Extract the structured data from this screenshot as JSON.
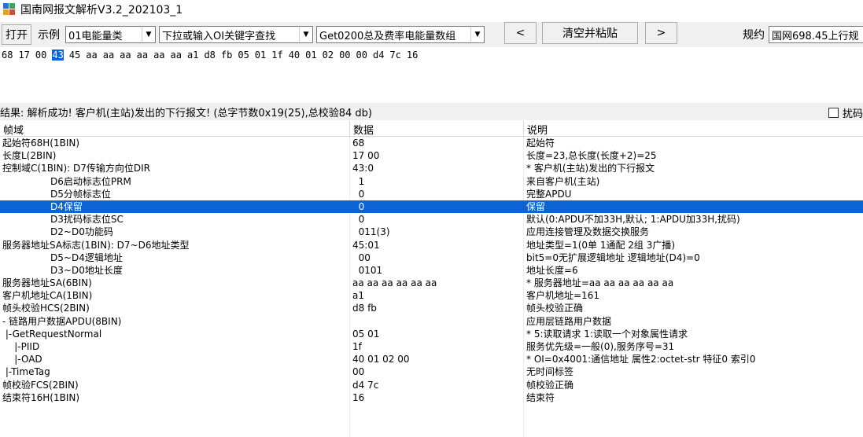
{
  "window": {
    "title": "国南网报文解析V3.2_202103_1"
  },
  "toolbar": {
    "open_label": "打开",
    "example_label": "示例",
    "example_combo": "01电能量类",
    "keyword_combo": "下拉或输入OI关键字查找",
    "frame_combo": "Get0200总及费率电能量数组",
    "prev_label": "<",
    "clear_paste_label": "清空并粘贴",
    "next_label": ">",
    "protocol_label": "规约",
    "protocol_value": "国网698.45上行规"
  },
  "hex": {
    "bytes": [
      "68",
      "17",
      "00",
      "43",
      "45",
      "aa",
      "aa",
      "aa",
      "aa",
      "aa",
      "aa",
      "a1",
      "d8",
      "fb",
      "05",
      "01",
      "1f",
      "40",
      "01",
      "02",
      "00",
      "00",
      "d4",
      "7c",
      "16"
    ],
    "selected_index": 3
  },
  "result": {
    "text": "结果: 解析成功! 客户机(主站)发出的下行报文! (总字节数0x19(25),总校验84 db)",
    "checkbox_label": "扰码"
  },
  "grid": {
    "headers": [
      "帧域",
      "数据",
      "说明"
    ],
    "selected_row": 5,
    "rows": [
      [
        "起始符68H(1BIN)",
        "68",
        "起始符"
      ],
      [
        "长度L(2BIN)",
        "17 00",
        "长度=23,总长度(长度+2)=25"
      ],
      [
        "控制域C(1BIN): D7传输方向位DIR",
        "43:0",
        "* 客户机(主站)发出的下行报文"
      ],
      [
        "                D6启动标志位PRM",
        "  1",
        "来自客户机(主站)"
      ],
      [
        "                D5分帧标志位",
        "  0",
        "完整APDU"
      ],
      [
        "                D4保留",
        "  0",
        "保留"
      ],
      [
        "                D3扰码标志位SC",
        "  0",
        "默认(0:APDU不加33H,默认; 1:APDU加33H,扰码)"
      ],
      [
        "                D2~D0功能码",
        "  011(3)",
        "应用连接管理及数据交换服务"
      ],
      [
        "服务器地址SA标志(1BIN): D7~D6地址类型",
        "45:01",
        "地址类型=1(0单 1通配 2组 3广播)"
      ],
      [
        "                D5~D4逻辑地址",
        "  00",
        "bit5=0无扩展逻辑地址 逻辑地址(D4)=0"
      ],
      [
        "                D3~D0地址长度",
        "  0101",
        "地址长度=6"
      ],
      [
        "服务器地址SA(6BIN)",
        "aa aa aa aa aa aa",
        "* 服务器地址=aa aa aa aa aa aa"
      ],
      [
        "客户机地址CA(1BIN)",
        "a1",
        "客户机地址=161"
      ],
      [
        "帧头校验HCS(2BIN)",
        "d8 fb",
        "帧头校验正确"
      ],
      [
        "- 链路用户数据APDU(8BIN)",
        "",
        "应用层链路用户数据"
      ],
      [
        " |-GetRequestNormal",
        "05 01",
        "* 5:读取请求 1:读取一个对象属性请求"
      ],
      [
        "    |-PIID",
        "1f",
        "服务优先级=一般(0),服务序号=31"
      ],
      [
        "    |-OAD",
        "40 01 02 00",
        "* OI=0x4001:通信地址 属性2:octet-str 特征0 索引0"
      ],
      [
        " |-TimeTag",
        "00",
        "无时间标签"
      ],
      [
        "帧校验FCS(2BIN)",
        "d4 7c",
        "帧校验正确"
      ],
      [
        "结束符16H(1BIN)",
        "16",
        "结束符"
      ]
    ]
  }
}
